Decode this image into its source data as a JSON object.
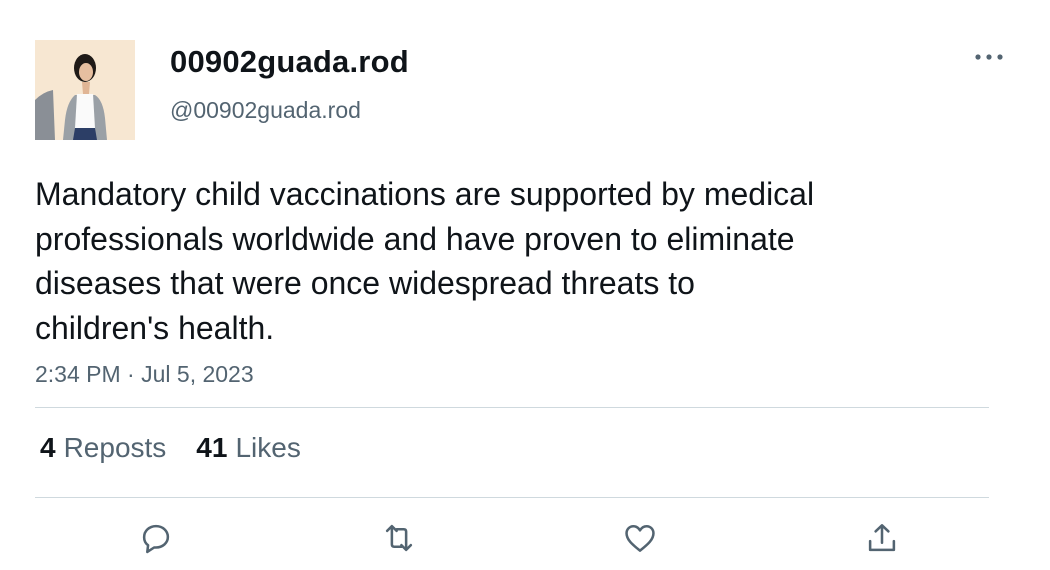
{
  "user": {
    "display_name": "00902guada.rod",
    "handle": "@00902guada.rod",
    "avatar_icon": "profile-photo"
  },
  "tweet": {
    "text_lines": [
      "Mandatory child vaccinations are supported by medical",
      "professionals worldwide and have proven to eliminate",
      "diseases that were once widespread threats to",
      "children's health."
    ],
    "time": "2:34 PM",
    "separator": "·",
    "date": "Jul 5, 2023"
  },
  "stats": {
    "reposts_count": "4",
    "reposts_label": "Reposts",
    "likes_count": "41",
    "likes_label": "Likes"
  },
  "actions": {
    "reply_icon": "reply-icon",
    "repost_icon": "repost-icon",
    "like_icon": "heart-icon",
    "share_icon": "share-icon"
  },
  "colors": {
    "text_primary": "#0f1419",
    "text_secondary": "#536471",
    "divider": "#cfd9de"
  }
}
